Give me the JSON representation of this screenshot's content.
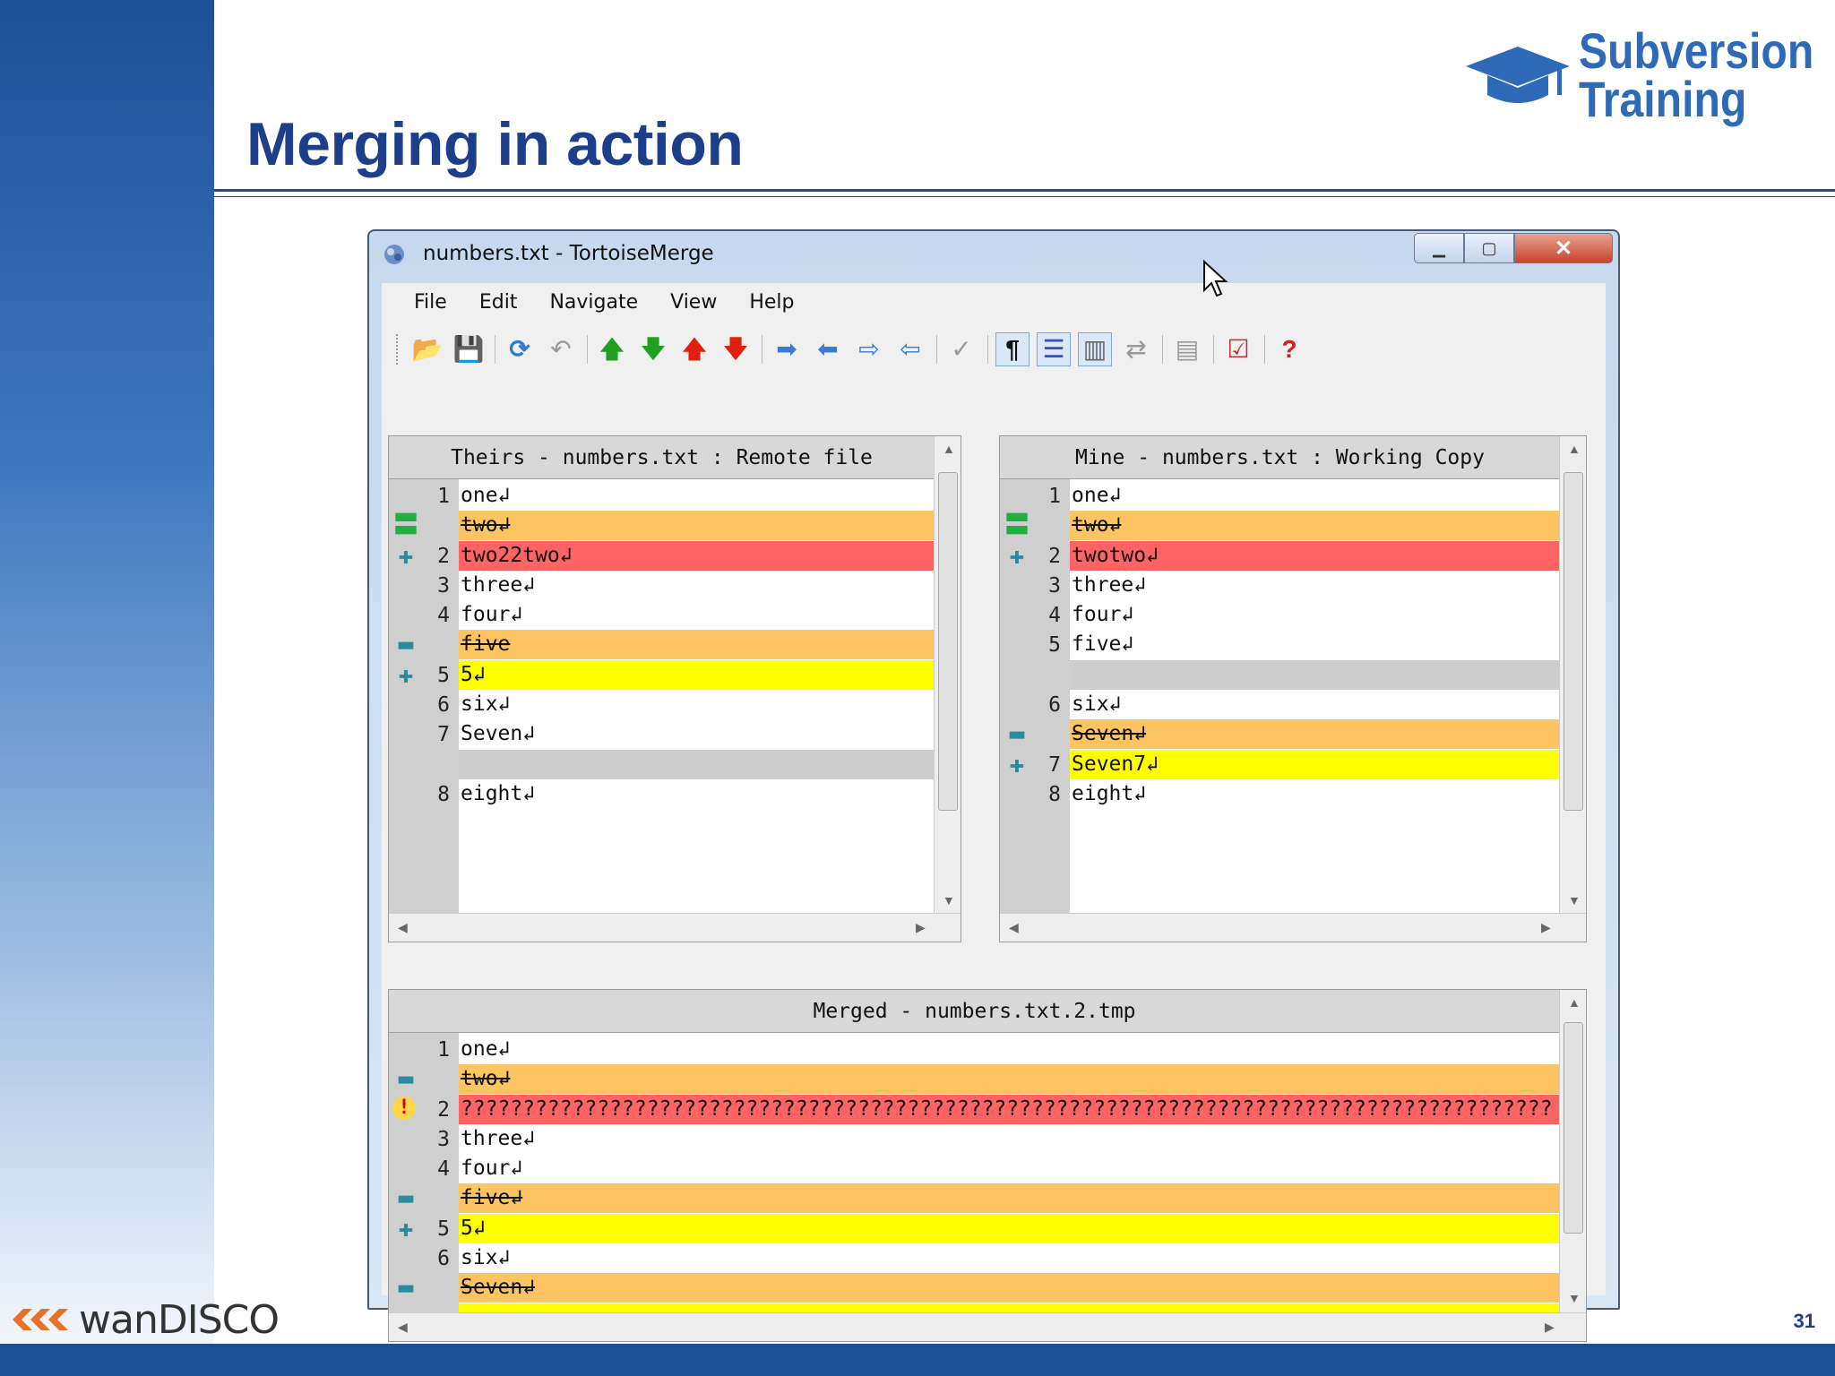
{
  "slide": {
    "title": "Merging in action",
    "logo_line1": "Subversion",
    "logo_line2": "Training",
    "footer_brand": "wanDISCO",
    "page_number": "31",
    "colors": {
      "brand_blue": "#1d3f8b",
      "band_blue": "#1c4f96",
      "logo_blue": "#2e6ab8"
    }
  },
  "window": {
    "title": "numbers.txt - TortoiseMerge",
    "menu": [
      "File",
      "Edit",
      "Navigate",
      "View",
      "Help"
    ],
    "toolbar_icons": [
      "open-icon",
      "save-icon",
      "reload-icon",
      "undo-icon",
      "previous-difference-icon",
      "next-difference-icon",
      "previous-conflict-icon",
      "next-conflict-icon",
      "use-theirs-icon",
      "use-mine-icon",
      "use-theirs-before-mine-icon",
      "use-mine-before-theirs-icon",
      "mark-resolved-icon",
      "whitespace-icon",
      "inline-diff-icon",
      "one-pane-view-icon",
      "switch-left-right-icon",
      "patch-icon",
      "resolved-check-icon",
      "help-icon"
    ]
  },
  "panes": {
    "theirs": {
      "header": "Theirs - numbers.txt : Remote file",
      "lines": [
        {
          "num": "1",
          "text": "one↲",
          "state": "unchanged",
          "marker": ""
        },
        {
          "num": "",
          "text": "two↲",
          "state": "removed",
          "marker": "equal"
        },
        {
          "num": "2",
          "text": "two22two↲",
          "state": "conflicted",
          "marker": "plus"
        },
        {
          "num": "3",
          "text": "three↲",
          "state": "unchanged",
          "marker": ""
        },
        {
          "num": "4",
          "text": "four↲",
          "state": "unchanged",
          "marker": ""
        },
        {
          "num": "",
          "text": "five",
          "state": "removed",
          "marker": "minus"
        },
        {
          "num": "5",
          "text": "5↲",
          "state": "added",
          "marker": "plus"
        },
        {
          "num": "6",
          "text": "six↲",
          "state": "unchanged",
          "marker": ""
        },
        {
          "num": "7",
          "text": "Seven↲",
          "state": "unchanged",
          "marker": ""
        },
        {
          "num": "",
          "text": "",
          "state": "filler",
          "marker": ""
        },
        {
          "num": "8",
          "text": "eight↲",
          "state": "unchanged",
          "marker": ""
        }
      ]
    },
    "mine": {
      "header": "Mine - numbers.txt : Working Copy",
      "lines": [
        {
          "num": "1",
          "text": "one↲",
          "state": "unchanged",
          "marker": ""
        },
        {
          "num": "",
          "text": "two↲",
          "state": "removed",
          "marker": "equal"
        },
        {
          "num": "2",
          "text": "twotwo↲",
          "state": "conflicted",
          "marker": "plus"
        },
        {
          "num": "3",
          "text": "three↲",
          "state": "unchanged",
          "marker": ""
        },
        {
          "num": "4",
          "text": "four↲",
          "state": "unchanged",
          "marker": ""
        },
        {
          "num": "5",
          "text": "five↲",
          "state": "unchanged",
          "marker": ""
        },
        {
          "num": "",
          "text": "",
          "state": "filler",
          "marker": ""
        },
        {
          "num": "6",
          "text": "six↲",
          "state": "unchanged",
          "marker": ""
        },
        {
          "num": "",
          "text": "Seven↲",
          "state": "removed",
          "marker": "minus"
        },
        {
          "num": "7",
          "text": "Seven7↲",
          "state": "added",
          "marker": "plus"
        },
        {
          "num": "8",
          "text": "eight↲",
          "state": "unchanged",
          "marker": ""
        }
      ]
    },
    "merged": {
      "header": "Merged - numbers.txt.2.tmp",
      "lines": [
        {
          "num": "1",
          "text": "one↲",
          "state": "unchanged",
          "marker": ""
        },
        {
          "num": "",
          "text": "two↲",
          "state": "removed",
          "marker": "minus"
        },
        {
          "num": "2",
          "text": "????????????????????????????????????????????????????????????????????????????????????????",
          "state": "conflicted",
          "marker": "warn"
        },
        {
          "num": "3",
          "text": "three↲",
          "state": "unchanged",
          "marker": ""
        },
        {
          "num": "4",
          "text": "four↲",
          "state": "unchanged",
          "marker": ""
        },
        {
          "num": "",
          "text": "five↲",
          "state": "removed",
          "marker": "minus"
        },
        {
          "num": "5",
          "text": "5↲",
          "state": "added",
          "marker": "plus"
        },
        {
          "num": "6",
          "text": "six↲",
          "state": "unchanged",
          "marker": ""
        },
        {
          "num": "",
          "text": "Seven↲",
          "state": "removed",
          "marker": "minus"
        },
        {
          "num": "",
          "text": "",
          "state": "added",
          "marker": "plus"
        }
      ]
    }
  },
  "state_colors": {
    "removed": "#fdc462",
    "conflicted": "#ff6363",
    "added": "#ffff00",
    "filler": "#cdcdcd"
  }
}
